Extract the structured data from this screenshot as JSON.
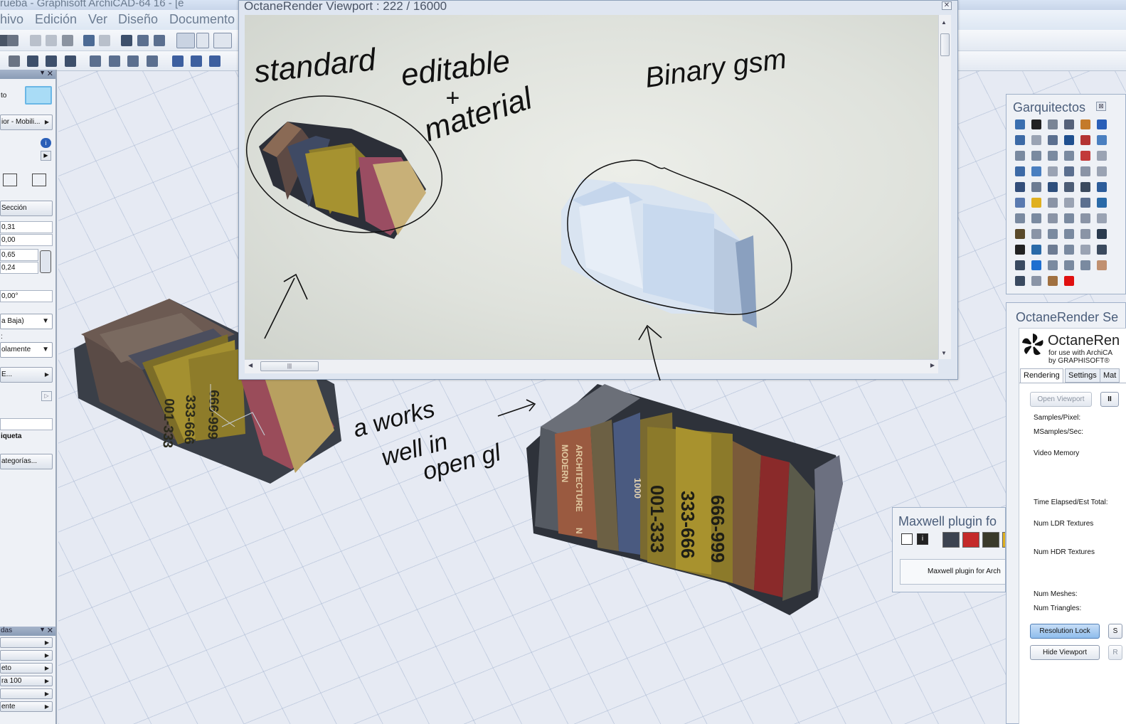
{
  "main_window": {
    "title": "rueba - Graphisoft ArchiCAD-64 16 - [e"
  },
  "menu": {
    "items": [
      "hivo",
      "Edición",
      "Ver",
      "Diseño",
      "Documento"
    ]
  },
  "info_box": {
    "field_to": "to",
    "library_path": "ior - Mobili...",
    "section_button": "Sección",
    "values": [
      "0,31",
      "0,00",
      "0,65",
      "0,24",
      "0,00°"
    ],
    "story_select": "a Baja)",
    "display_select": "olamente",
    "fe_button": "E...",
    "label_title": "iqueta",
    "categories_button": "ategorías..."
  },
  "bottom_palette": {
    "title": "das",
    "rows": [
      "",
      "",
      "eto",
      "ra 100",
      "",
      "ente"
    ]
  },
  "octane_viewport": {
    "title": "OctaneRender Viewport : 222  / 16000",
    "annotations": {
      "standard": "standard",
      "editable": "editable",
      "plus": "+",
      "material": "material",
      "binary": "Binary gsm",
      "works1": "a works",
      "works2": "well in",
      "works3": "open gl"
    }
  },
  "book_labels": {
    "spine1": "001-333",
    "spine2": "333-666",
    "spine3": "666-999",
    "modern": "MODERN",
    "architecture": "ARCHITECTURE",
    "n": "N",
    "num1000": "1000"
  },
  "garquitectos": {
    "title": "Garquitectos",
    "close": "⊠",
    "icon_colors": [
      "#3a6fb0",
      "#222222",
      "#7a8596",
      "#56627a",
      "#c47a2a",
      "#2a5fb8",
      "#3d6aa6",
      "#9aa3b3",
      "#5b6f8f",
      "#1f4f8f",
      "#b33333",
      "#4a7fc0",
      "#7a8aa0",
      "#7a8aa0",
      "#7a8aa0",
      "#7a8aa0",
      "#c23a3a",
      "#9aa3b3",
      "#3d6aa6",
      "#4a7fc0",
      "#9aa3b3",
      "#5b6f8f",
      "#8a94a6",
      "#9aa3b3",
      "#334e7a",
      "#6d7c93",
      "#2e4f7d",
      "#4d5d76",
      "#3b4a5e",
      "#2c5c9a",
      "#5a7ab0",
      "#e0b020",
      "#8a94a6",
      "#9aa3b3",
      "#5b6f8f",
      "#2a6aa8",
      "#7a8aa0",
      "#7a8aa0",
      "#8a94a6",
      "#7a8aa0",
      "#8a94a6",
      "#9aa3b3",
      "#5a4a2a",
      "#8a94a6",
      "#7a8aa0",
      "#7a8aa0",
      "#8a94a6",
      "#2a3a4e",
      "#222222",
      "#2a6aa8",
      "#6d7c93",
      "#7a8aa0",
      "#9aa3b3",
      "#3b4a5e",
      "#3a4a60",
      "#1f6fd0",
      "#7a8aa0",
      "#7a8aa0",
      "#7a8aa0",
      "#c09070",
      "#3a4a60",
      "#8a94a6",
      "#a07040",
      "#e01010"
    ]
  },
  "octane_settings": {
    "title": "OctaneRender Se",
    "logo_name": "OctaneRen",
    "logo_sub1": "for use with ArchiCA",
    "logo_sub2": "by GRAPHISOFT®",
    "tabs": [
      "Rendering",
      "Settings",
      "Mat"
    ],
    "open_viewport": "Open Viewport",
    "pause": "II",
    "labels": {
      "samples_pixel": "Samples/Pixel:",
      "msamples": "MSamples/Sec:",
      "video_memory": "Video Memory",
      "time_elapsed": "Time Elapsed/Est Total:",
      "ldr": "Num LDR Textures",
      "hdr": "Num HDR Textures",
      "meshes": "Num Meshes:",
      "triangles": "Num Triangles:"
    },
    "resolution_lock": "Resolution Lock",
    "hide_viewport": "Hide Viewport",
    "s_button": "S",
    "r_button": "R"
  },
  "maxwell": {
    "title": "Maxwell plugin fo",
    "footer": "Maxwell plugin for Arch"
  }
}
